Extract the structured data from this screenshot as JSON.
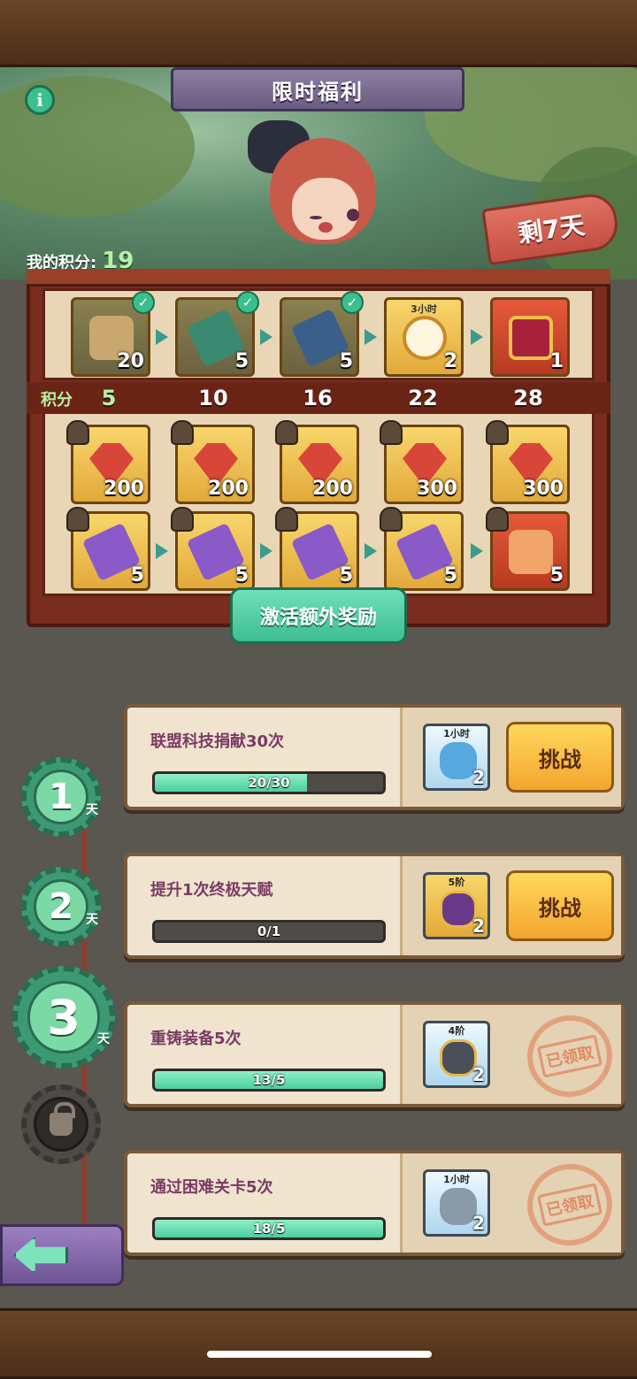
{
  "header": {
    "title": "限时福利",
    "info_label": "i",
    "days_left": "剩7天"
  },
  "points": {
    "label": "我的积分:",
    "value": "19"
  },
  "shelf": {
    "top_rewards": [
      {
        "qty": "20",
        "claimed": true,
        "icon": "puzzle-piece"
      },
      {
        "qty": "5",
        "claimed": true,
        "icon": "green-ticket"
      },
      {
        "qty": "5",
        "claimed": true,
        "icon": "blue-ticket"
      },
      {
        "qty": "2",
        "claimed": false,
        "icon": "clock",
        "label": "3小时"
      },
      {
        "qty": "1",
        "claimed": false,
        "icon": "treasure-chest"
      }
    ],
    "score_label": "积分",
    "thresholds": [
      "5",
      "10",
      "16",
      "22",
      "28"
    ],
    "gem_rewards": [
      "200",
      "200",
      "200",
      "300",
      "300"
    ],
    "ticket_rewards": [
      "5",
      "5",
      "5",
      "5",
      "5"
    ],
    "activate_label": "激活额外奖励"
  },
  "days": [
    {
      "num": "1",
      "unit": "天",
      "state": "done"
    },
    {
      "num": "2",
      "unit": "天",
      "state": "done"
    },
    {
      "num": "3",
      "unit": "天",
      "state": "current"
    },
    {
      "num": "",
      "unit": "",
      "state": "locked"
    }
  ],
  "tasks": [
    {
      "title": "联盟科技捐献30次",
      "progress_text": "20/30",
      "progress": 0.667,
      "reward_label": "1小时",
      "reward_qty": "2",
      "reward_icon": "hourglass",
      "action": "挑战"
    },
    {
      "title": "提升1次终极天赋",
      "progress_text": "0/1",
      "progress": 0,
      "reward_label": "5阶",
      "reward_qty": "2",
      "reward_icon": "purple-chest",
      "action": "挑战"
    },
    {
      "title": "重铸装备5次",
      "progress_text": "13/5",
      "progress": 1,
      "reward_label": "4阶",
      "reward_qty": "2",
      "reward_icon": "chest",
      "action": "已领取"
    },
    {
      "title": "通过困难关卡5次",
      "progress_text": "18/5",
      "progress": 1,
      "reward_label": "1小时",
      "reward_qty": "2",
      "reward_icon": "hourglass",
      "action": "已领取"
    }
  ],
  "colors": {
    "accent_green": "#3bbf8c",
    "progress_fill": "#4ccfa0",
    "task_title": "#7a3b64",
    "challenge_button": "#f3a52e"
  }
}
